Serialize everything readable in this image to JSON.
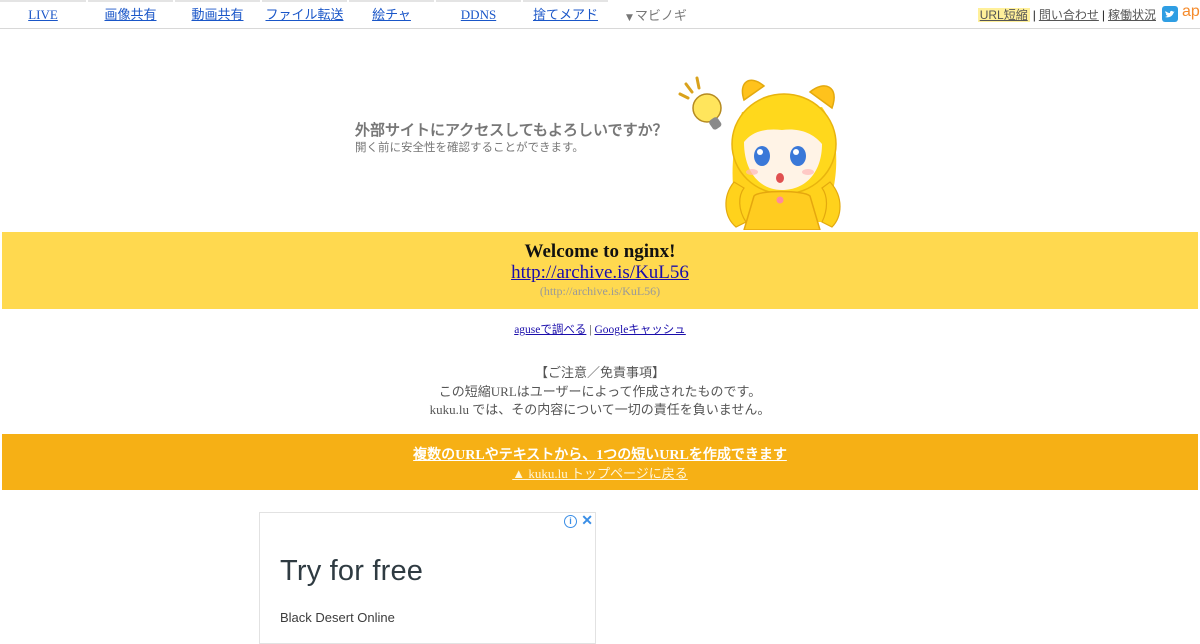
{
  "nav": {
    "tabs": [
      "LIVE",
      "画像共有",
      "動画共有",
      "ファイル転送",
      "絵チャ",
      "DDNS",
      "捨てメアド"
    ],
    "dropdown_label": "マビノギ"
  },
  "toplinks": {
    "url_short": "URL短縮",
    "contact": "問い合わせ",
    "status": "稼働状況",
    "separator": "|",
    "ap": "ap"
  },
  "hero": {
    "title": "外部サイトにアクセスしてもよろしいですか？",
    "subtitle": "開く前に安全性を確認することができます。"
  },
  "target": {
    "heading": "Welcome to nginx!",
    "url": "http://archive.is/KuL56",
    "url_paren": "(http://archive.is/KuL56)"
  },
  "check_links": {
    "aguse": "aguseで調べる",
    "separator": "|",
    "google_cache": "Googleキャッシュ"
  },
  "notice": {
    "title": "【ご注意／免責事項】",
    "line1": "この短縮URLはユーザーによって作成されたものです。",
    "line2": "kuku.lu では、その内容について一切の責任を負いません。"
  },
  "promo": {
    "link": "複数のURLやテキストから、1つの短いURLを作成できます",
    "back": "▲ kuku.lu トップページに戻る"
  },
  "ad": {
    "headline": "Try for free",
    "advertiser": "Black Desert Online",
    "info_glyph": "i",
    "close_glyph": "✕"
  },
  "colors": {
    "yellow_band": "#ffd94f",
    "orange_band": "#f6b015",
    "link_blue": "#1a0dab"
  },
  "icons": {
    "dropdown": "triangle-down-icon",
    "twitter": "twitter-icon",
    "mascot": "mascot-illustration",
    "ad_info": "info-icon",
    "ad_close": "close-icon"
  }
}
